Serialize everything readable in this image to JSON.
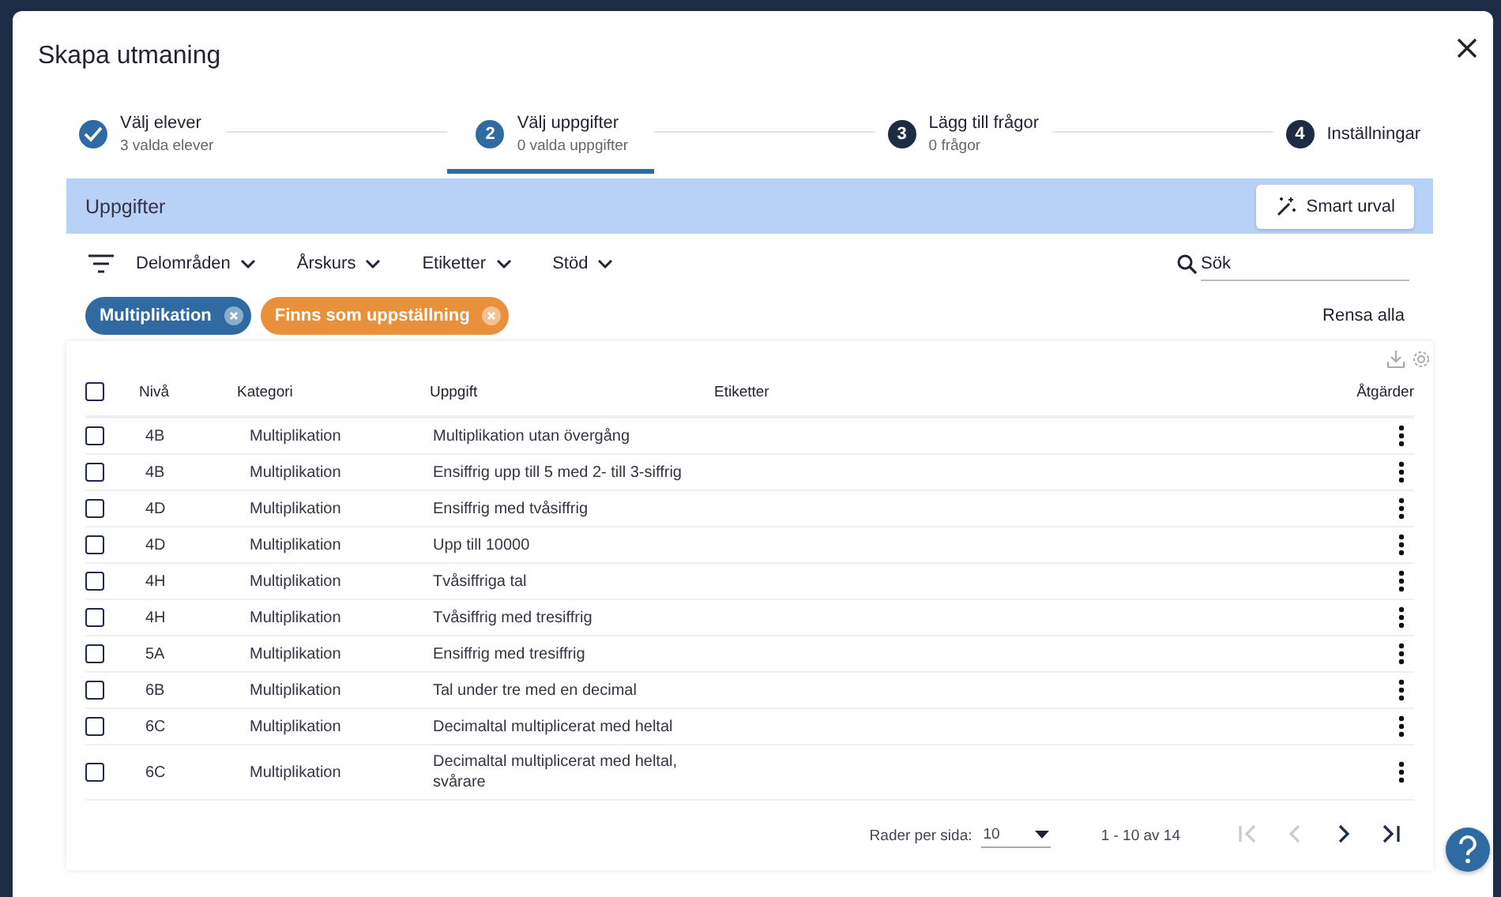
{
  "dialog": {
    "title": "Skapa utmaning"
  },
  "steps": [
    {
      "title": "Välj elever",
      "subtitle": "3 valda elever",
      "completed": true,
      "selected": false
    },
    {
      "number": "2",
      "title": "Välj uppgifter",
      "subtitle": "0 valda uppgifter",
      "completed": false,
      "selected": true
    },
    {
      "number": "3",
      "title": "Lägg till frågor",
      "subtitle": "0 frågor",
      "completed": false,
      "selected": false
    },
    {
      "number": "4",
      "title": "Inställningar",
      "completed": false,
      "selected": false
    }
  ],
  "panel": {
    "title": "Uppgifter",
    "smart_button": "Smart urval"
  },
  "filters": [
    "Delområden",
    "Årskurs",
    "Etiketter",
    "Stöd"
  ],
  "search": {
    "placeholder": "Sök"
  },
  "chips": [
    {
      "label": "Multiplikation",
      "color": "#2f6aa3"
    },
    {
      "label": "Finns som uppställning",
      "color": "#e8903a"
    }
  ],
  "clear_all": "Rensa alla",
  "table": {
    "columns": [
      "Nivå",
      "Kategori",
      "Uppgift",
      "Etiketter",
      "Åtgärder"
    ],
    "header_checked": false,
    "rows": [
      {
        "level": "4B",
        "category": "Multiplikation",
        "task": "Multiplikation utan övergång",
        "checked": false
      },
      {
        "level": "4B",
        "category": "Multiplikation",
        "task": "Ensiffrig upp till 5 med 2- till 3-siffrig",
        "checked": false
      },
      {
        "level": "4D",
        "category": "Multiplikation",
        "task": "Ensiffrig med tvåsiffrig",
        "checked": false
      },
      {
        "level": "4D",
        "category": "Multiplikation",
        "task": "Upp till 10000",
        "checked": false
      },
      {
        "level": "4H",
        "category": "Multiplikation",
        "task": "Tvåsiffriga tal",
        "checked": false
      },
      {
        "level": "4H",
        "category": "Multiplikation",
        "task": "Tvåsiffrig med tresiffrig",
        "checked": false
      },
      {
        "level": "5A",
        "category": "Multiplikation",
        "task": "Ensiffrig med tresiffrig",
        "checked": false
      },
      {
        "level": "6B",
        "category": "Multiplikation",
        "task": "Tal under tre med en decimal",
        "checked": false
      },
      {
        "level": "6C",
        "category": "Multiplikation",
        "task": "Decimaltal multiplicerat med heltal",
        "checked": false
      },
      {
        "level": "6C",
        "category": "Multiplikation",
        "task": "Decimaltal multiplicerat med heltal, svårare",
        "checked": false
      }
    ]
  },
  "pagination": {
    "rows_label": "Rader per sida:",
    "rows_value": "10",
    "range": "1 - 10 av 14",
    "buttons": [
      {
        "kind": "first",
        "disabled": true
      },
      {
        "kind": "prev",
        "disabled": true
      },
      {
        "kind": "next",
        "disabled": false
      },
      {
        "kind": "last",
        "disabled": false
      }
    ]
  }
}
